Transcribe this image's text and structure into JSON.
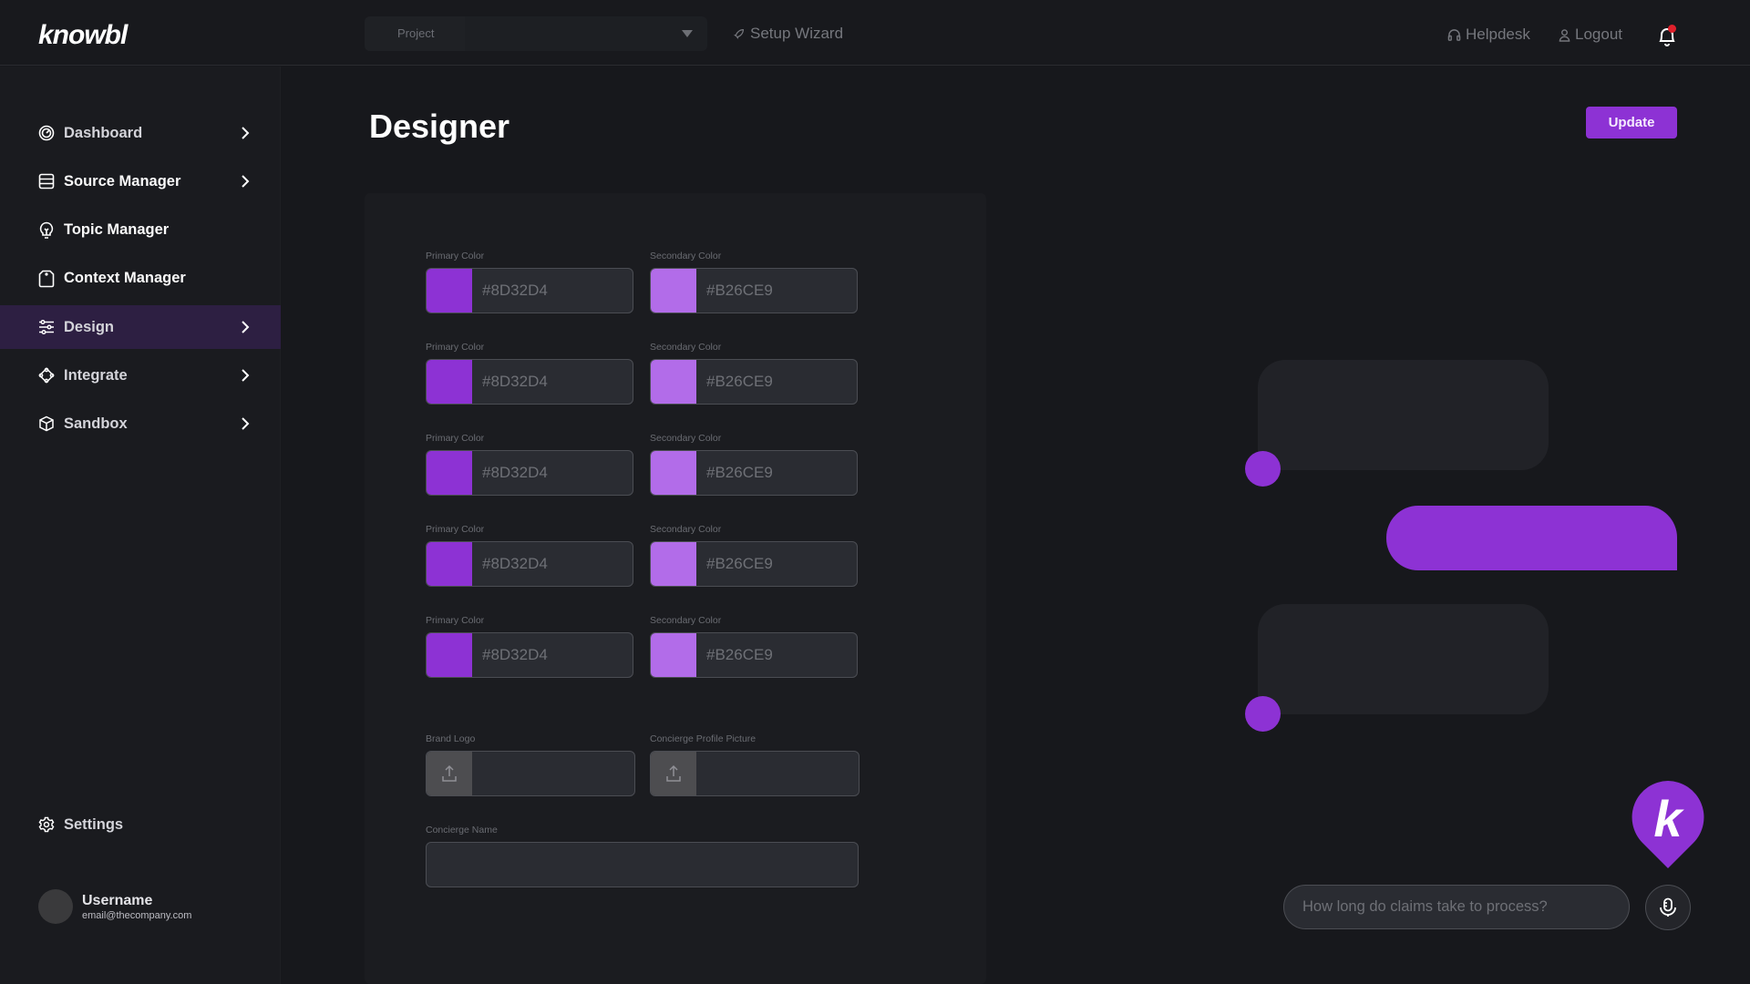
{
  "header": {
    "logo": "knowbl",
    "project_select": {
      "label": "Project",
      "icon": "caret-down-icon"
    },
    "setup_wizard": {
      "label": "Setup Wizard",
      "icon": "rocket-icon"
    },
    "helpdesk": {
      "label": "Helpdesk",
      "icon": "headset-icon"
    },
    "logout": {
      "label": "Logout",
      "icon": "user-icon"
    },
    "notifications": {
      "icon": "bell-icon",
      "has_unread": true,
      "badge_color": "#e0202b"
    }
  },
  "sidebar": {
    "items": [
      {
        "label": "Dashboard",
        "icon": "gauge-icon",
        "has_chevron": true,
        "active": false
      },
      {
        "label": "Source Manager",
        "icon": "database-icon",
        "has_chevron": true,
        "active": false
      },
      {
        "label": "Topic Manager",
        "icon": "lightbulb-icon",
        "has_chevron": false,
        "active": false
      },
      {
        "label": "Context Manager",
        "icon": "tag-icon",
        "has_chevron": false,
        "active": false
      },
      {
        "label": "Design",
        "icon": "sliders-icon",
        "has_chevron": true,
        "active": true
      },
      {
        "label": "Integrate",
        "icon": "integrate-icon",
        "has_chevron": true,
        "active": false
      },
      {
        "label": "Sandbox",
        "icon": "cube-icon",
        "has_chevron": true,
        "active": false
      }
    ],
    "settings": {
      "label": "Settings",
      "icon": "gear-icon"
    },
    "user": {
      "name": "Username",
      "email": "email@thecompany.com"
    }
  },
  "main": {
    "title": "Designer",
    "update_button": "Update",
    "color_rows": [
      {
        "primary_label": "Primary Color",
        "primary_value": "#8D32D4",
        "secondary_label": "Secondary Color",
        "secondary_value": "#B26CE9"
      },
      {
        "primary_label": "Primary Color",
        "primary_value": "#8D32D4",
        "secondary_label": "Secondary Color",
        "secondary_value": "#B26CE9"
      },
      {
        "primary_label": "Primary Color",
        "primary_value": "#8D32D4",
        "secondary_label": "Secondary Color",
        "secondary_value": "#B26CE9"
      },
      {
        "primary_label": "Primary Color",
        "primary_value": "#8D32D4",
        "secondary_label": "Secondary Color",
        "secondary_value": "#B26CE9"
      },
      {
        "primary_label": "Primary Color",
        "primary_value": "#8D32D4",
        "secondary_label": "Secondary Color",
        "secondary_value": "#B26CE9"
      }
    ],
    "brand_logo_label": "Brand Logo",
    "concierge_picture_label": "Concierge Profile Picture",
    "concierge_name_label": "Concierge Name",
    "concierge_name_value": ""
  },
  "preview": {
    "accent_color": "#8D32D4",
    "secondary_color": "#B26CE9",
    "chat_input_placeholder": "How long do claims take to process?",
    "launcher_letter": "k",
    "mic_icon": "microphone-icon"
  }
}
